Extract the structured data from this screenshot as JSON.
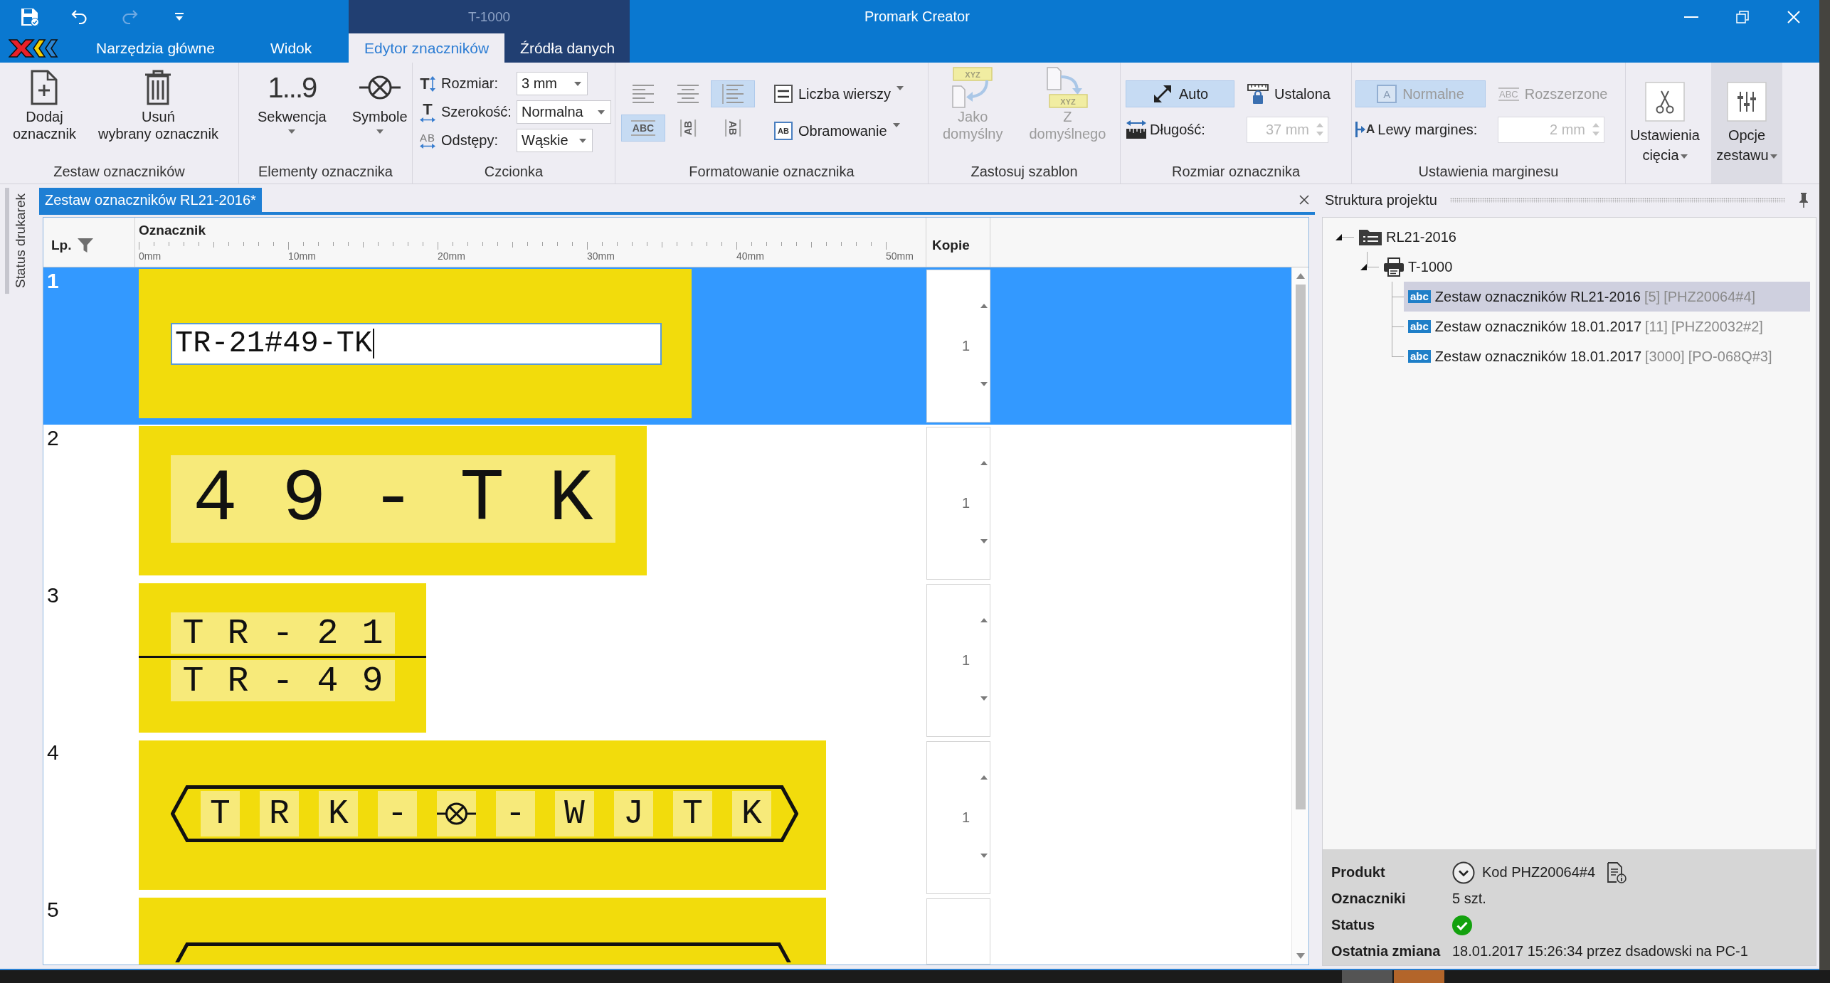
{
  "title_bar": {
    "quick_access": [
      {
        "kind": "save",
        "disabled": false
      },
      {
        "kind": "undo",
        "disabled": false
      },
      {
        "kind": "redo",
        "disabled": true
      },
      {
        "kind": "customize",
        "disabled": false
      }
    ],
    "context_title": "T-1000",
    "title": "Promark Creator"
  },
  "ribbon_tabs": [
    {
      "label": "Narzędzia główne",
      "selected": false,
      "contextual": false
    },
    {
      "label": "Widok",
      "selected": false,
      "contextual": false
    },
    {
      "label": "Edytor znaczników",
      "selected": true,
      "contextual": true
    },
    {
      "label": "Źródła danych",
      "selected": false,
      "contextual": true
    }
  ],
  "ribbon": {
    "marker_set": {
      "label": "Zestaw oznaczników",
      "buttons": [
        {
          "kind": "add",
          "label": "Dodaj\noznacznik"
        },
        {
          "kind": "delete",
          "label": "Usuń\nwybrany oznacznik"
        }
      ]
    },
    "marker_elements": {
      "label": "Elementy oznacznika",
      "buttons": [
        {
          "kind": "sequence",
          "glyph": "1...9",
          "label": "Sekwencja"
        },
        {
          "kind": "symbols",
          "label": "Symbole"
        }
      ]
    },
    "font": {
      "label": "Czcionka",
      "fields": [
        {
          "kind": "size",
          "glyph": "T",
          "label": "Rozmiar:",
          "value": "3 mm"
        },
        {
          "kind": "width",
          "glyph": "T",
          "label": "Szerokość:",
          "value": "Normalna"
        },
        {
          "kind": "spacing",
          "glyph": "AB",
          "label": "Odstępy:",
          "value": "Wąskie"
        }
      ]
    },
    "formatting": {
      "label": "Formatowanie oznacznika",
      "alignment": [
        {
          "kind": "left",
          "selected": false
        },
        {
          "kind": "center",
          "selected": false
        },
        {
          "kind": "justify",
          "selected": true
        }
      ],
      "orientation": [
        {
          "kind": "horizontal",
          "glyph": "ABC",
          "selected": true
        },
        {
          "kind": "rotate_left",
          "glyph": "AB",
          "selected": false
        },
        {
          "kind": "rotate_right",
          "glyph": "AB",
          "selected": false
        }
      ],
      "menus": [
        {
          "kind": "rows",
          "label": "Liczba wierszy"
        },
        {
          "kind": "border",
          "glyph": "AB",
          "label": "Obramowanie"
        }
      ]
    },
    "template": {
      "label": "Zastosuj szablon",
      "buttons": [
        {
          "kind": "save_default",
          "glyph": "XYZ",
          "label": "Jako\ndomyślny",
          "disabled": true
        },
        {
          "kind": "load_default",
          "glyph": "XYZ",
          "label": "Z\ndomyślnego",
          "disabled": true
        }
      ]
    },
    "marker_size": {
      "label": "Rozmiar oznacznika",
      "modes": [
        {
          "kind": "auto",
          "label": "Auto",
          "selected": true
        },
        {
          "kind": "fixed",
          "label": "Ustalona",
          "selected": false
        }
      ],
      "length": {
        "label": "Długość:",
        "value": "37 mm",
        "disabled": true
      }
    },
    "margin": {
      "label": "Ustawienia marginesu",
      "modes": [
        {
          "kind": "normal",
          "glyph": "A",
          "label": "Normalne",
          "selected": true,
          "disabled": true
        },
        {
          "kind": "extended",
          "glyph": "ABC",
          "label": "Rozszerzone",
          "selected": false,
          "disabled": true
        }
      ],
      "left_margin": {
        "glyph": "A",
        "label": "Lewy margines:",
        "value": "2 mm",
        "disabled": true
      }
    },
    "options": {
      "buttons": [
        {
          "kind": "cutting",
          "label": "Ustawienia\ncięcia",
          "selected": false
        },
        {
          "kind": "set_options",
          "label": "Opcje\nzestawu",
          "selected": true
        }
      ]
    }
  },
  "side_panel": {
    "label": "Status drukarek"
  },
  "document": {
    "tab": "Zestaw oznaczników RL21-2016*",
    "columns": [
      {
        "kind": "number",
        "label": "Lp."
      },
      {
        "kind": "marker",
        "label": "Oznacznik"
      },
      {
        "kind": "copies",
        "label": "Kopie"
      }
    ],
    "ruler": [
      "0mm",
      "10mm",
      "20mm",
      "30mm",
      "40mm",
      "50mm"
    ],
    "rows": [
      {
        "number": "1",
        "selected": true,
        "kind": "editing",
        "text": "TR-21#49-TK",
        "copies": "1"
      },
      {
        "number": "2",
        "selected": false,
        "kind": "lines",
        "lines": [
          [
            "4",
            "9",
            "-",
            "T",
            "K"
          ]
        ],
        "copies": "1"
      },
      {
        "number": "3",
        "selected": false,
        "kind": "lines",
        "lines": [
          [
            "T",
            "R",
            "-",
            "2",
            "1"
          ],
          [
            "T",
            "R",
            "-",
            "4",
            "9"
          ]
        ],
        "copies": "1"
      },
      {
        "number": "4",
        "selected": false,
        "kind": "framed",
        "cells": [
          {
            "kind": "char",
            "text": "T"
          },
          {
            "kind": "char",
            "text": "R"
          },
          {
            "kind": "char",
            "text": "K"
          },
          {
            "kind": "char",
            "text": "-"
          },
          {
            "kind": "symbol"
          },
          {
            "kind": "char",
            "text": "-"
          },
          {
            "kind": "char",
            "text": "W"
          },
          {
            "kind": "char",
            "text": "J"
          },
          {
            "kind": "char",
            "text": "T"
          },
          {
            "kind": "char",
            "text": "K"
          }
        ],
        "copies": "1"
      },
      {
        "number": "5",
        "selected": false,
        "kind": "framed_cut"
      }
    ]
  },
  "project_tree": {
    "title": "Struktura projektu",
    "items": [
      {
        "kind": "project",
        "label": "RL21-2016",
        "selected": false,
        "expanded": true,
        "children": [
          {
            "kind": "printer",
            "label": "T-1000",
            "selected": false,
            "expanded": true,
            "children": [
              {
                "kind": "marker_set",
                "glyph": "abc",
                "label": "Zestaw oznaczników RL21-2016",
                "count": "[5]",
                "code": "[PHZ20064#4]",
                "selected": true
              },
              {
                "kind": "marker_set",
                "glyph": "abc",
                "label": "Zestaw oznaczników 18.01.2017",
                "count": "[11]",
                "code": "[PHZ20032#2]",
                "selected": false
              },
              {
                "kind": "marker_set",
                "glyph": "abc",
                "label": "Zestaw oznaczników 18.01.2017",
                "count": "[3000]",
                "code": "[PO-068Q#3]",
                "selected": false
              }
            ]
          }
        ]
      }
    ]
  },
  "details": {
    "rows": [
      {
        "kind": "product",
        "label": "Produkt",
        "value": "Kod PHZ20064#4"
      },
      {
        "kind": "text",
        "label": "Oznaczniki",
        "value": "5 szt."
      },
      {
        "kind": "status",
        "label": "Status",
        "ok": true
      },
      {
        "kind": "text",
        "label": "Ostatnia zmiana",
        "value": "18.01.2017 15:26:34 przez dsadowski na PC-1"
      }
    ]
  }
}
